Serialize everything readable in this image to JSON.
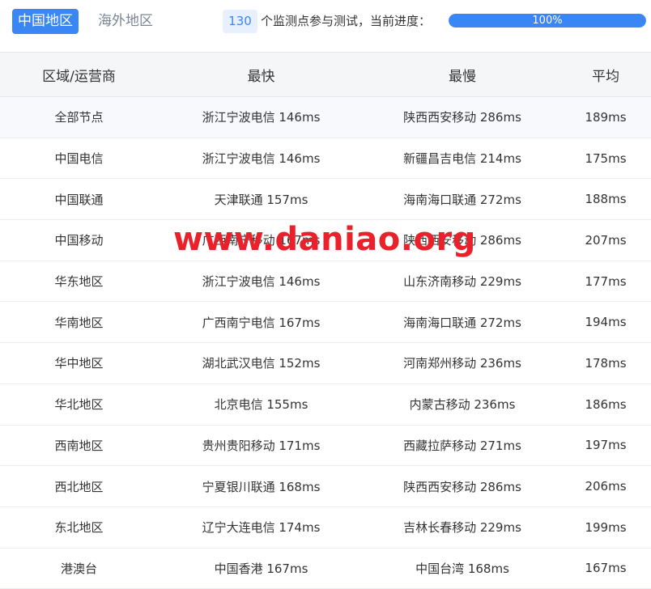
{
  "tabs": {
    "china": "中国地区",
    "overseas": "海外地区"
  },
  "status": {
    "node_count": "130",
    "text": "个监测点参与测试，当前进度：",
    "progress_label": "100%",
    "progress_value": 1.0
  },
  "table": {
    "headers": [
      "区域/运营商",
      "最快",
      "最慢",
      "平均"
    ],
    "rows": [
      [
        "全部节点",
        "浙江宁波电信 146ms",
        "陕西西安移动 286ms",
        "189ms"
      ],
      [
        "中国电信",
        "浙江宁波电信 146ms",
        "新疆昌吉电信 214ms",
        "175ms"
      ],
      [
        "中国联通",
        "天津联通 157ms",
        "海南海口联通 272ms",
        "188ms"
      ],
      [
        "中国移动",
        "广西南宁移动 167ms",
        "陕西西安移动 286ms",
        "207ms"
      ],
      [
        "华东地区",
        "浙江宁波电信 146ms",
        "山东济南移动 229ms",
        "177ms"
      ],
      [
        "华南地区",
        "广西南宁电信 167ms",
        "海南海口联通 272ms",
        "194ms"
      ],
      [
        "华中地区",
        "湖北武汉电信 152ms",
        "河南郑州移动 236ms",
        "178ms"
      ],
      [
        "华北地区",
        "北京电信 155ms",
        "内蒙古移动 236ms",
        "186ms"
      ],
      [
        "西南地区",
        "贵州贵阳移动 171ms",
        "西藏拉萨移动 271ms",
        "197ms"
      ],
      [
        "西北地区",
        "宁夏银川联通 168ms",
        "陕西西安移动 286ms",
        "206ms"
      ],
      [
        "东北地区",
        "辽宁大连电信 174ms",
        "吉林长春移动 229ms",
        "199ms"
      ],
      [
        "港澳台",
        "中国香港 167ms",
        "中国台湾 168ms",
        "167ms"
      ]
    ]
  },
  "watermark": "www.daniao.org",
  "colors": {
    "accent": "#3a86f4",
    "watermark": "#e8212b"
  }
}
